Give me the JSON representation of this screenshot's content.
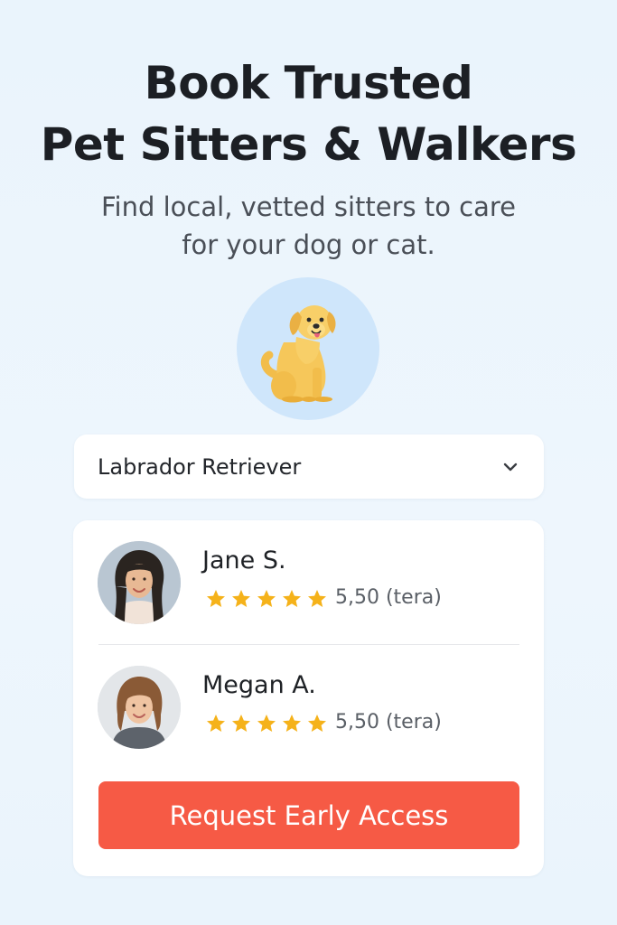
{
  "header": {
    "title_line1": "Book Trusted",
    "title_line2": "Pet Sitters & Walkers",
    "subtitle_line1": "Find local, vetted sitters to care",
    "subtitle_line2": "for your dog or cat."
  },
  "hero": {
    "icon": "dog-illustration-icon"
  },
  "breed_select": {
    "value": "Labrador Retriever",
    "icon": "chevron-down-icon"
  },
  "sitters": [
    {
      "name": "Jane S.",
      "rating_text": "5,50 (tera)",
      "stars": 5
    },
    {
      "name": "Megan A.",
      "rating_text": "5,50 (tera)",
      "stars": 5
    }
  ],
  "cta": {
    "label": "Request Early Access"
  },
  "colors": {
    "background": "#eaf4fc",
    "accent": "#f65a45",
    "star": "#f5b21a",
    "hero_circle": "#cfe6fb"
  }
}
